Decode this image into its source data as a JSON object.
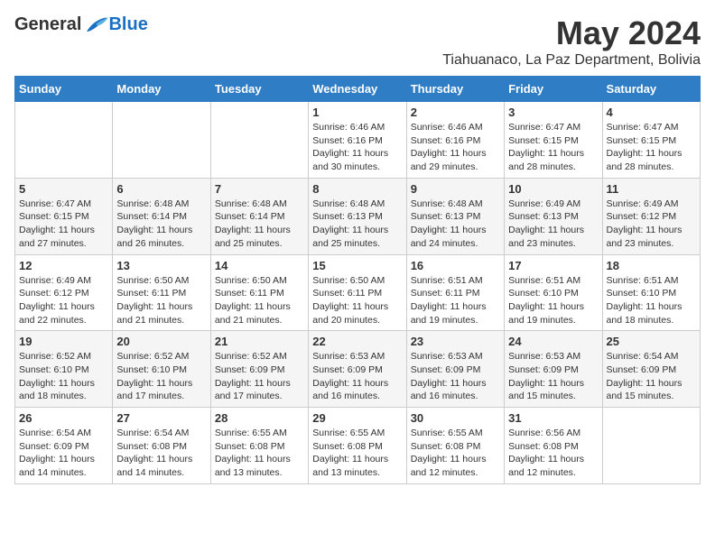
{
  "logo": {
    "general": "General",
    "blue": "Blue"
  },
  "title": "May 2024",
  "location": "Tiahuanaco, La Paz Department, Bolivia",
  "days_of_week": [
    "Sunday",
    "Monday",
    "Tuesday",
    "Wednesday",
    "Thursday",
    "Friday",
    "Saturday"
  ],
  "weeks": [
    [
      {
        "day": "",
        "info": ""
      },
      {
        "day": "",
        "info": ""
      },
      {
        "day": "",
        "info": ""
      },
      {
        "day": "1",
        "info": "Sunrise: 6:46 AM\nSunset: 6:16 PM\nDaylight: 11 hours and 30 minutes."
      },
      {
        "day": "2",
        "info": "Sunrise: 6:46 AM\nSunset: 6:16 PM\nDaylight: 11 hours and 29 minutes."
      },
      {
        "day": "3",
        "info": "Sunrise: 6:47 AM\nSunset: 6:15 PM\nDaylight: 11 hours and 28 minutes."
      },
      {
        "day": "4",
        "info": "Sunrise: 6:47 AM\nSunset: 6:15 PM\nDaylight: 11 hours and 28 minutes."
      }
    ],
    [
      {
        "day": "5",
        "info": "Sunrise: 6:47 AM\nSunset: 6:15 PM\nDaylight: 11 hours and 27 minutes."
      },
      {
        "day": "6",
        "info": "Sunrise: 6:48 AM\nSunset: 6:14 PM\nDaylight: 11 hours and 26 minutes."
      },
      {
        "day": "7",
        "info": "Sunrise: 6:48 AM\nSunset: 6:14 PM\nDaylight: 11 hours and 25 minutes."
      },
      {
        "day": "8",
        "info": "Sunrise: 6:48 AM\nSunset: 6:13 PM\nDaylight: 11 hours and 25 minutes."
      },
      {
        "day": "9",
        "info": "Sunrise: 6:48 AM\nSunset: 6:13 PM\nDaylight: 11 hours and 24 minutes."
      },
      {
        "day": "10",
        "info": "Sunrise: 6:49 AM\nSunset: 6:13 PM\nDaylight: 11 hours and 23 minutes."
      },
      {
        "day": "11",
        "info": "Sunrise: 6:49 AM\nSunset: 6:12 PM\nDaylight: 11 hours and 23 minutes."
      }
    ],
    [
      {
        "day": "12",
        "info": "Sunrise: 6:49 AM\nSunset: 6:12 PM\nDaylight: 11 hours and 22 minutes."
      },
      {
        "day": "13",
        "info": "Sunrise: 6:50 AM\nSunset: 6:11 PM\nDaylight: 11 hours and 21 minutes."
      },
      {
        "day": "14",
        "info": "Sunrise: 6:50 AM\nSunset: 6:11 PM\nDaylight: 11 hours and 21 minutes."
      },
      {
        "day": "15",
        "info": "Sunrise: 6:50 AM\nSunset: 6:11 PM\nDaylight: 11 hours and 20 minutes."
      },
      {
        "day": "16",
        "info": "Sunrise: 6:51 AM\nSunset: 6:11 PM\nDaylight: 11 hours and 19 minutes."
      },
      {
        "day": "17",
        "info": "Sunrise: 6:51 AM\nSunset: 6:10 PM\nDaylight: 11 hours and 19 minutes."
      },
      {
        "day": "18",
        "info": "Sunrise: 6:51 AM\nSunset: 6:10 PM\nDaylight: 11 hours and 18 minutes."
      }
    ],
    [
      {
        "day": "19",
        "info": "Sunrise: 6:52 AM\nSunset: 6:10 PM\nDaylight: 11 hours and 18 minutes."
      },
      {
        "day": "20",
        "info": "Sunrise: 6:52 AM\nSunset: 6:10 PM\nDaylight: 11 hours and 17 minutes."
      },
      {
        "day": "21",
        "info": "Sunrise: 6:52 AM\nSunset: 6:09 PM\nDaylight: 11 hours and 17 minutes."
      },
      {
        "day": "22",
        "info": "Sunrise: 6:53 AM\nSunset: 6:09 PM\nDaylight: 11 hours and 16 minutes."
      },
      {
        "day": "23",
        "info": "Sunrise: 6:53 AM\nSunset: 6:09 PM\nDaylight: 11 hours and 16 minutes."
      },
      {
        "day": "24",
        "info": "Sunrise: 6:53 AM\nSunset: 6:09 PM\nDaylight: 11 hours and 15 minutes."
      },
      {
        "day": "25",
        "info": "Sunrise: 6:54 AM\nSunset: 6:09 PM\nDaylight: 11 hours and 15 minutes."
      }
    ],
    [
      {
        "day": "26",
        "info": "Sunrise: 6:54 AM\nSunset: 6:09 PM\nDaylight: 11 hours and 14 minutes."
      },
      {
        "day": "27",
        "info": "Sunrise: 6:54 AM\nSunset: 6:08 PM\nDaylight: 11 hours and 14 minutes."
      },
      {
        "day": "28",
        "info": "Sunrise: 6:55 AM\nSunset: 6:08 PM\nDaylight: 11 hours and 13 minutes."
      },
      {
        "day": "29",
        "info": "Sunrise: 6:55 AM\nSunset: 6:08 PM\nDaylight: 11 hours and 13 minutes."
      },
      {
        "day": "30",
        "info": "Sunrise: 6:55 AM\nSunset: 6:08 PM\nDaylight: 11 hours and 12 minutes."
      },
      {
        "day": "31",
        "info": "Sunrise: 6:56 AM\nSunset: 6:08 PM\nDaylight: 11 hours and 12 minutes."
      },
      {
        "day": "",
        "info": ""
      }
    ]
  ]
}
